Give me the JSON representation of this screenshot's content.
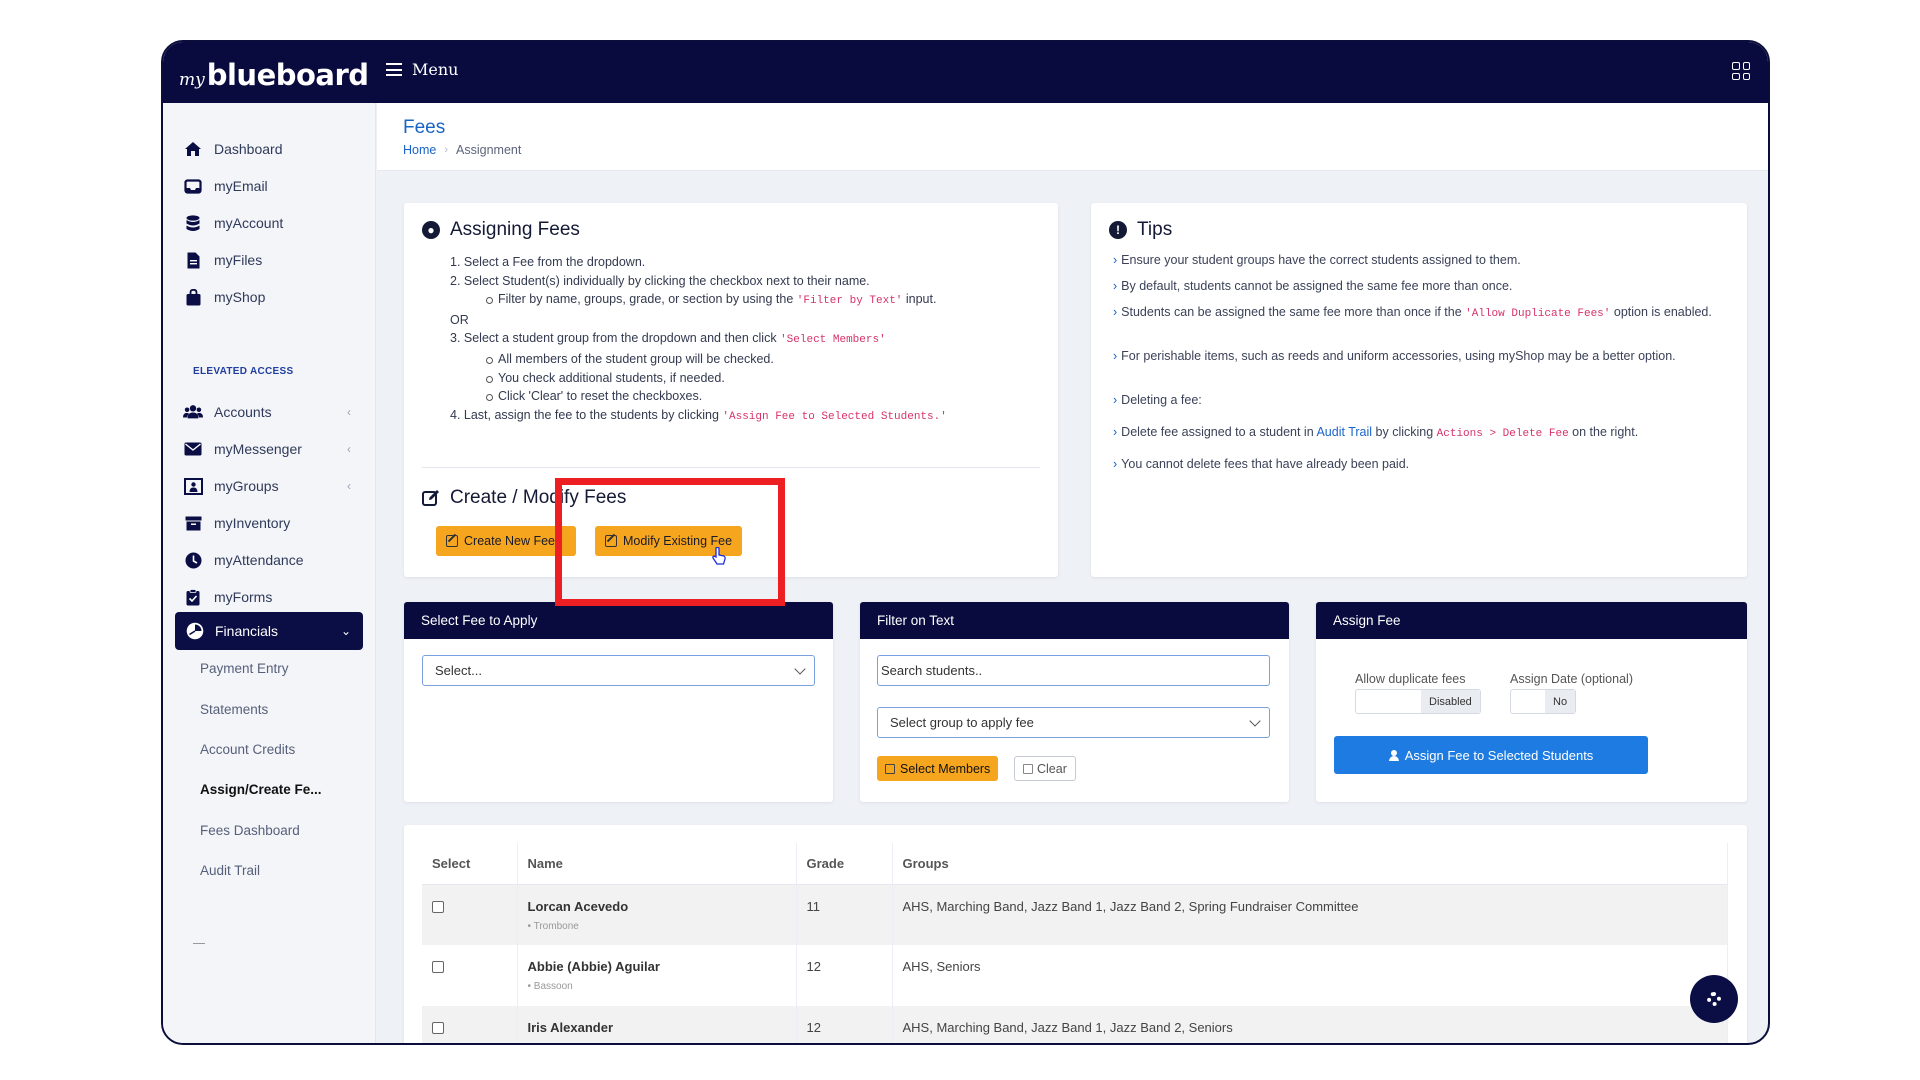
{
  "topbar": {
    "logo_my": "my",
    "logo_brand": "blueboard",
    "menu_label": "Menu"
  },
  "sidebar": {
    "items": [
      {
        "label": "Dashboard"
      },
      {
        "label": "myEmail"
      },
      {
        "label": "myAccount"
      },
      {
        "label": "myFiles"
      },
      {
        "label": "myShop"
      }
    ],
    "section_label": "ELEVATED ACCESS",
    "elevated": [
      {
        "label": "Accounts"
      },
      {
        "label": "myMessenger"
      },
      {
        "label": "myGroups"
      },
      {
        "label": "myInventory"
      },
      {
        "label": "myAttendance"
      },
      {
        "label": "myForms"
      }
    ],
    "active": {
      "label": "Financials"
    },
    "sub": [
      {
        "label": "Payment Entry"
      },
      {
        "label": "Statements"
      },
      {
        "label": "Account Credits"
      },
      {
        "label": "Assign/Create Fe..."
      },
      {
        "label": "Fees Dashboard"
      },
      {
        "label": "Audit Trail"
      }
    ]
  },
  "page": {
    "title": "Fees",
    "breadcrumb_home": "Home",
    "breadcrumb_current": "Assignment"
  },
  "assigning": {
    "title": "Assigning Fees",
    "l1": "1. Select a Fee from the dropdown.",
    "l2": "2. Select Student(s) individually by clicking the checkbox next to their name.",
    "l3a": "Filter by name, groups, grade, or section by using the ",
    "l3code": "'Filter by Text'",
    "l3b": " input.",
    "l4": "OR",
    "l5a": "3. Select a student group from the dropdown and then click ",
    "l5code": "'Select Members'",
    "l6": "All members of the student group will be checked.",
    "l7": "You check additional students, if needed.",
    "l8": "Click 'Clear' to reset the checkboxes.",
    "l9a": "4. Last, assign the fee to the students by clicking ",
    "l9code": "'Assign Fee to Selected Students.'"
  },
  "create": {
    "title": "Create / Modify Fees",
    "create_btn": "Create New Fee",
    "modify_btn": "Modify Existing Fee"
  },
  "tips": {
    "title": "Tips",
    "t1": "Ensure your student groups have the correct students assigned to them.",
    "t2": "By default, students cannot be assigned the same fee more than once.",
    "t3a": "Students can be assigned the same fee more than once if the ",
    "t3code": "'Allow Duplicate Fees'",
    "t3b": " option is enabled.",
    "t4": "For perishable items, such as reeds and uniform accessories, using myShop may be a better option.",
    "t5": "Deleting a fee:",
    "t6a": "Delete fee assigned to a student in ",
    "t6link": "Audit Trail",
    "t6b": " by clicking ",
    "t6code": "Actions > Delete Fee",
    "t6c": " on the right.",
    "t7": "You cannot delete fees that have already been paid."
  },
  "select_fee": {
    "header": "Select Fee to Apply",
    "selected": "Select..."
  },
  "filter": {
    "header": "Filter on Text",
    "search_placeholder": "Search students..",
    "group_selected": "Select group to apply fee",
    "select_members_btn": "Select Members",
    "clear_btn": "Clear"
  },
  "assign": {
    "header": "Assign Fee",
    "dup_label": "Allow duplicate fees",
    "dup_state": "Disabled",
    "date_label": "Assign Date (optional)",
    "date_state": "No",
    "assign_btn": "Assign Fee to Selected Students"
  },
  "table": {
    "headers": {
      "select": "Select",
      "name": "Name",
      "grade": "Grade",
      "groups": "Groups"
    },
    "rows": [
      {
        "name": "Lorcan Acevedo",
        "instrument": "Trombone",
        "grade": "11",
        "groups": "AHS, Marching Band, Jazz Band 1, Jazz Band 2, Spring Fundraiser Committee"
      },
      {
        "name": "Abbie (Abbie) Aguilar",
        "instrument": "Bassoon",
        "grade": "12",
        "groups": "AHS, Seniors"
      },
      {
        "name": "Iris Alexander",
        "instrument": "",
        "grade": "12",
        "groups": "AHS, Marching Band, Jazz Band 1, Jazz Band 2, Seniors"
      }
    ]
  },
  "colors": {
    "navy": "#090b3f",
    "accent_blue": "#1a64c7",
    "orange": "#f6a61e",
    "button_blue": "#1e7be2",
    "highlight_red": "#ee1f23"
  }
}
